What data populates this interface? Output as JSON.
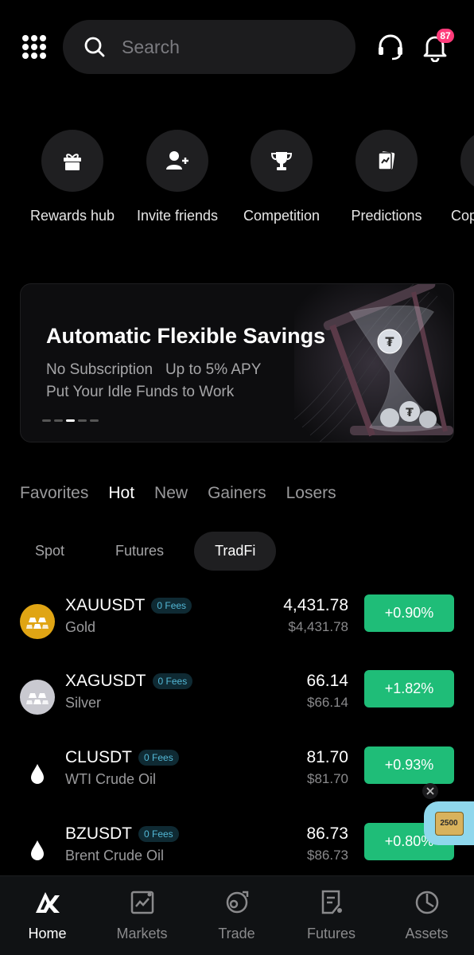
{
  "header": {
    "search_placeholder": "Search",
    "notification_count": "87",
    "icons": [
      "apps-grid-icon",
      "search-icon",
      "support-headset-icon",
      "bell-icon"
    ]
  },
  "shortcuts": [
    {
      "label": "Rewards hub",
      "icon": "gift-icon"
    },
    {
      "label": "Invite friends",
      "icon": "add-user-icon"
    },
    {
      "label": "Competition",
      "icon": "trophy-icon"
    },
    {
      "label": "Predictions",
      "icon": "cards-icon"
    },
    {
      "label": "Copy trading",
      "icon": "copy-icon"
    }
  ],
  "banner": {
    "title": "Automatic Flexible Savings",
    "line1": "No Subscription   Up to 5% APY",
    "line2": "Put Your Idle Funds to Work",
    "page_count": 5,
    "active_page": 3
  },
  "market_tabs": [
    "Favorites",
    "Hot",
    "New",
    "Gainers",
    "Losers"
  ],
  "active_market_tab": "Hot",
  "sub_tabs": [
    "Spot",
    "Futures",
    "TradFi"
  ],
  "active_sub_tab": "TradFi",
  "rows": [
    {
      "symbol": "XAUUSDT",
      "fee": "0 Fees",
      "name": "Gold",
      "price": "4,431.78",
      "fiat": "$4,431.78",
      "change": "+0.90%",
      "icon": "gold-bars-icon",
      "icon_color": "#e0a514"
    },
    {
      "symbol": "XAGUSDT",
      "fee": "0 Fees",
      "name": "Silver",
      "price": "66.14",
      "fiat": "$66.14",
      "change": "+1.82%",
      "icon": "silver-bars-icon",
      "icon_color": "#c9c9d0"
    },
    {
      "symbol": "CLUSDT",
      "fee": "0 Fees",
      "name": "WTI Crude Oil",
      "price": "81.70",
      "fiat": "$81.70",
      "change": "+0.93%",
      "icon": "oil-drop-icon",
      "icon_color": "#ffffff"
    },
    {
      "symbol": "BZUSDT",
      "fee": "0 Fees",
      "name": "Brent Crude Oil",
      "price": "86.73",
      "fiat": "$86.73",
      "change": "+0.80%",
      "icon": "oil-drop-icon",
      "icon_color": "#ffffff"
    }
  ],
  "promo": {
    "label": "2500"
  },
  "colors": {
    "positive": "#1fbd78",
    "badge": "#ff3b7a",
    "background": "#000000"
  },
  "bottom_nav": [
    {
      "label": "Home",
      "icon": "okx-logo-icon"
    },
    {
      "label": "Markets",
      "icon": "markets-chart-icon"
    },
    {
      "label": "Trade",
      "icon": "trade-icon"
    },
    {
      "label": "Futures",
      "icon": "futures-icon"
    },
    {
      "label": "Assets",
      "icon": "assets-pie-icon"
    }
  ],
  "active_nav": "Home"
}
